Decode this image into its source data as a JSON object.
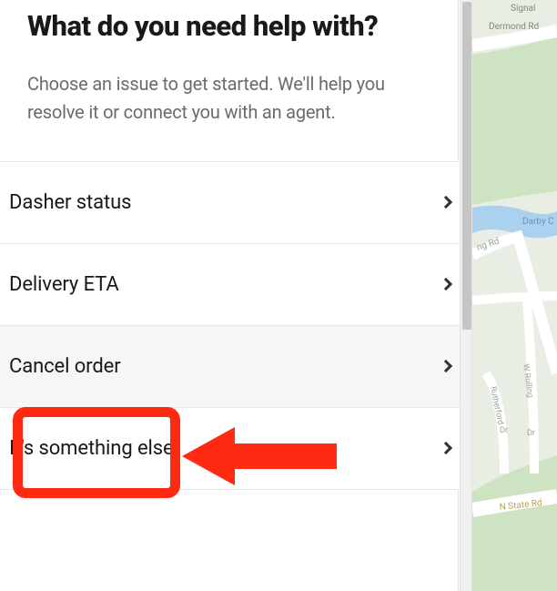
{
  "colors": {
    "annotation": "#ff2a12",
    "text_primary": "#191919",
    "text_secondary": "#6b6b6b",
    "divider": "#e7e7e7",
    "row_highlight_bg": "#f6f6f6"
  },
  "header": {
    "title": "What do you need help with?",
    "subtitle": "Choose an issue to get started. We'll help you resolve it or connect you with an agent."
  },
  "options": [
    {
      "label": "Dasher status",
      "highlighted": false
    },
    {
      "label": "Delivery ETA",
      "highlighted": false
    },
    {
      "label": "Cancel order",
      "highlighted": true
    },
    {
      "label": "It's something else",
      "highlighted": false
    }
  ],
  "map": {
    "street_labels": [
      "Signal",
      "Dermond Rd",
      "Darby C",
      "ng Rd",
      "Rutherford",
      "Dr",
      "W Rolling",
      "Dr",
      "N State Rd"
    ],
    "park_color": "#cde3c1",
    "water_color": "#aad2ef",
    "road_color": "#ffffff",
    "land_color": "#e9eee5"
  }
}
